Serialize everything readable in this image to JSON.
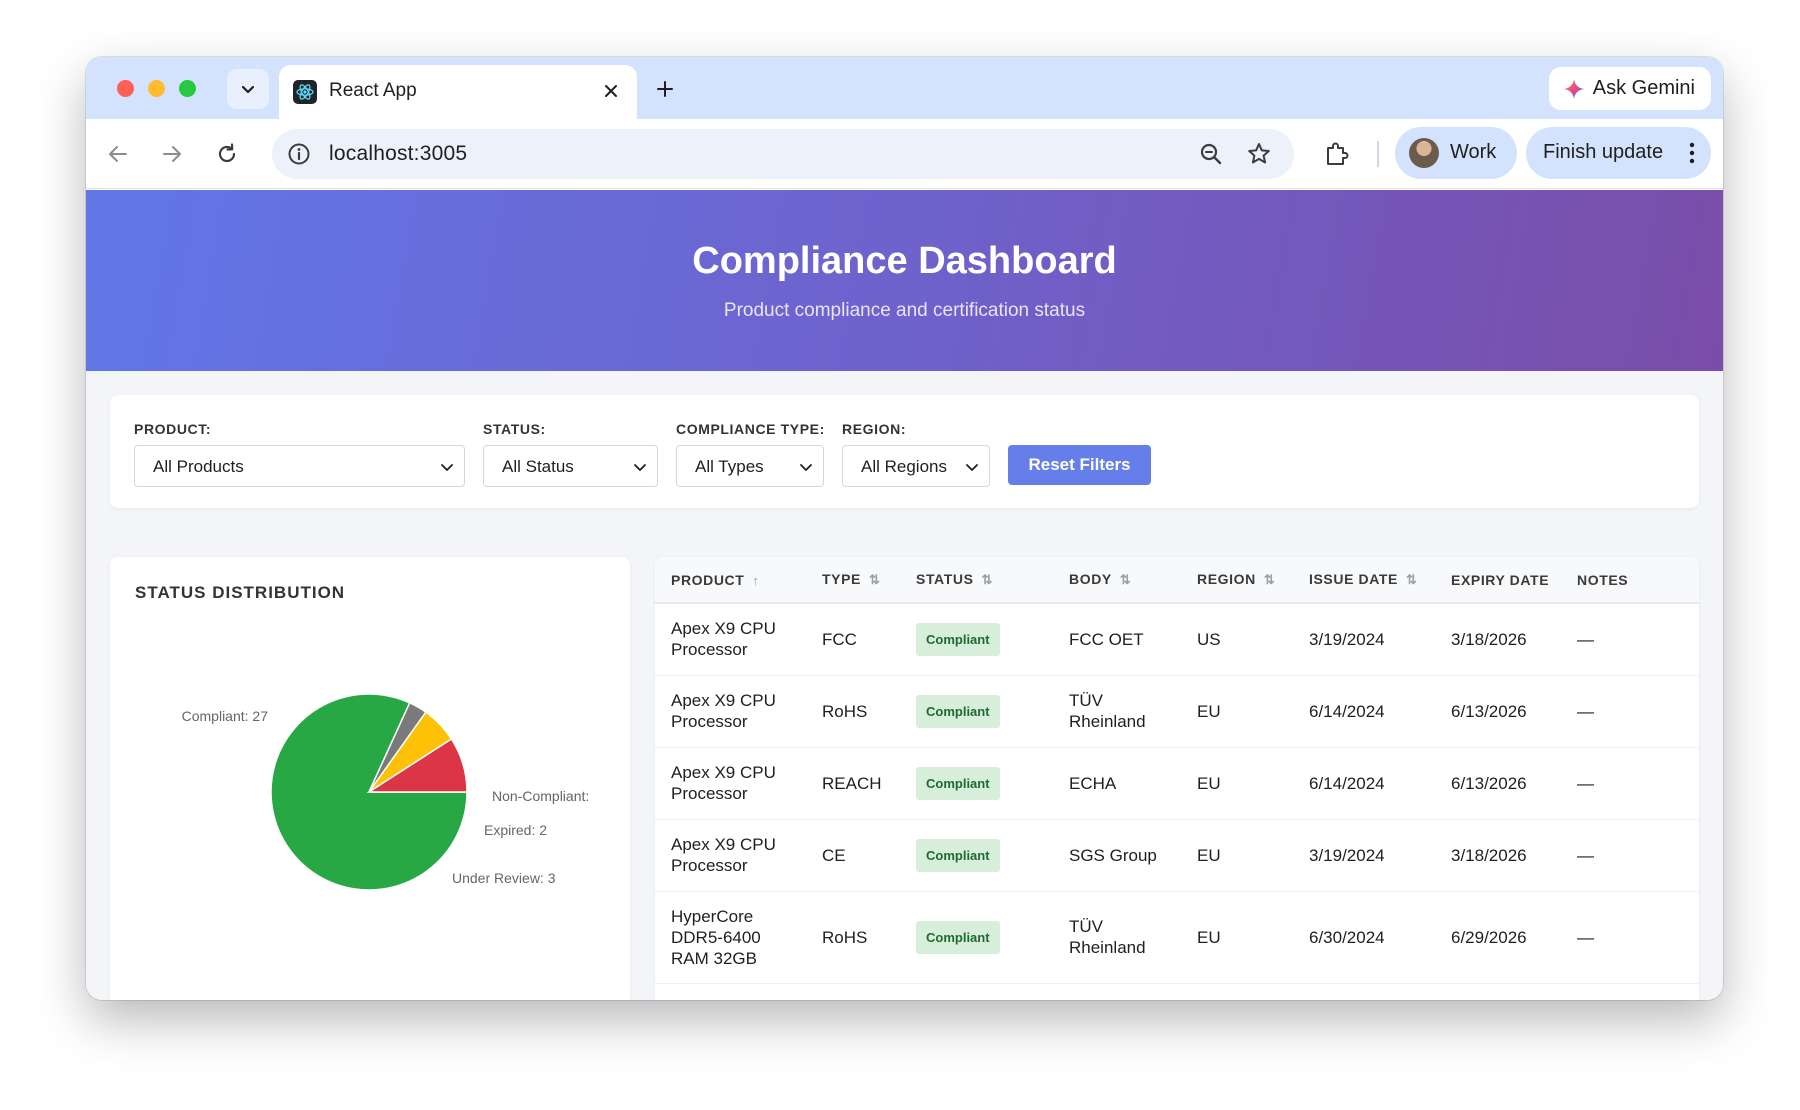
{
  "browser": {
    "tab_title": "React App",
    "url": "localhost:3005",
    "ask_gemini": "Ask Gemini",
    "profile": "Work",
    "finish_update": "Finish update"
  },
  "header": {
    "title": "Compliance Dashboard",
    "subtitle": "Product compliance and certification status"
  },
  "filters": {
    "product": {
      "label": "PRODUCT:",
      "value": "All Products"
    },
    "status": {
      "label": "STATUS:",
      "value": "All Status"
    },
    "type": {
      "label": "COMPLIANCE TYPE:",
      "value": "All Types"
    },
    "region": {
      "label": "REGION:",
      "value": "All Regions"
    },
    "reset": "Reset Filters"
  },
  "chart_data": {
    "type": "pie",
    "title": "STATUS DISTRIBUTION",
    "slices": [
      {
        "label": "Compliant: 27",
        "value": 27,
        "color": "#28a745"
      },
      {
        "label": "Non-Compliant:",
        "value": 1,
        "color": "#7a7a7a"
      },
      {
        "label": "Expired: 2",
        "value": 2,
        "color": "#ffc107"
      },
      {
        "label": "Under Review: 3",
        "value": 3,
        "color": "#dc3545"
      }
    ]
  },
  "table": {
    "columns": [
      "PRODUCT",
      "TYPE",
      "STATUS",
      "BODY",
      "REGION",
      "ISSUE DATE",
      "EXPIRY DATE",
      "NOTES"
    ],
    "sort_icons": [
      "↑",
      "⇅",
      "⇅",
      "⇅",
      "⇅",
      "⇅",
      "",
      ""
    ],
    "rows": [
      {
        "product": "Apex X9 CPU Processor",
        "type": "FCC",
        "status": "Compliant",
        "body": "FCC OET",
        "region": "US",
        "issue": "3/19/2024",
        "expiry": "3/18/2026",
        "notes": "—"
      },
      {
        "product": "Apex X9 CPU Processor",
        "type": "RoHS",
        "status": "Compliant",
        "body": "TÜV Rheinland",
        "region": "EU",
        "issue": "6/14/2024",
        "expiry": "6/13/2026",
        "notes": "—"
      },
      {
        "product": "Apex X9 CPU Processor",
        "type": "REACH",
        "status": "Compliant",
        "body": "ECHA",
        "region": "EU",
        "issue": "6/14/2024",
        "expiry": "6/13/2026",
        "notes": "—"
      },
      {
        "product": "Apex X9 CPU Processor",
        "type": "CE",
        "status": "Compliant",
        "body": "SGS Group",
        "region": "EU",
        "issue": "3/19/2024",
        "expiry": "3/18/2026",
        "notes": "—"
      },
      {
        "product": "HyperCore DDR5-6400 RAM 32GB",
        "type": "RoHS",
        "status": "Compliant",
        "body": "TÜV Rheinland",
        "region": "EU",
        "issue": "6/30/2024",
        "expiry": "6/29/2026",
        "notes": "—"
      }
    ]
  }
}
